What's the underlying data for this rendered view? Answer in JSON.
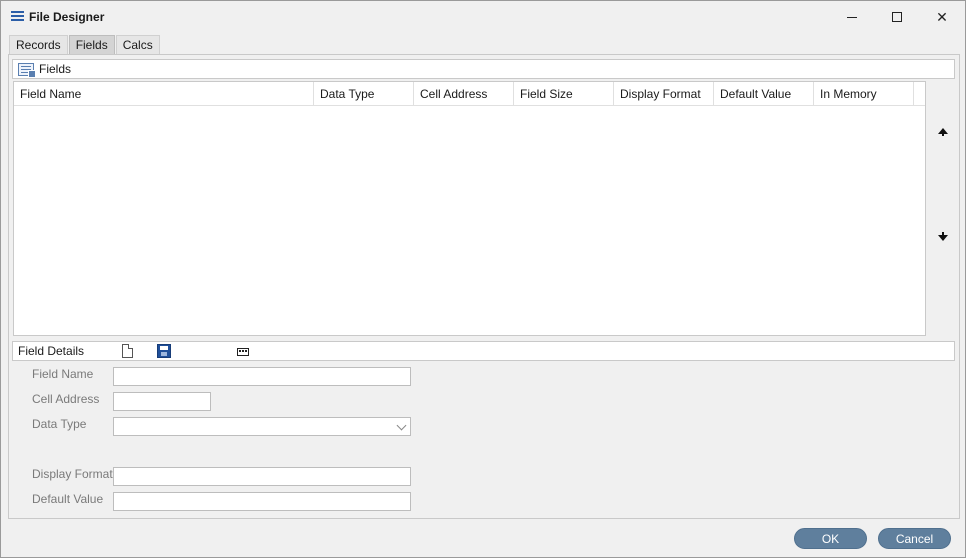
{
  "window": {
    "title": "File Designer",
    "icon": "menu-icon"
  },
  "tabs": [
    {
      "label": "Records",
      "active": false
    },
    {
      "label": "Fields",
      "active": true
    },
    {
      "label": "Calcs",
      "active": false
    }
  ],
  "fields_section": {
    "title": "Fields",
    "icon": "grid-icon",
    "columns": [
      "Field Name",
      "Data Type",
      "Cell Address",
      "Field Size",
      "Display Format",
      "Default Value",
      "In Memory"
    ],
    "rows": []
  },
  "field_details": {
    "title": "Field Details",
    "toolbar_icons": [
      "new-document-icon",
      "save-icon",
      "memory-icon"
    ],
    "form": {
      "field_name_label": "Field Name",
      "field_name_value": "",
      "cell_address_label": "Cell Address",
      "cell_address_value": "",
      "data_type_label": "Data Type",
      "data_type_value": "",
      "display_format_label": "Display Format",
      "display_format_value": "",
      "default_value_label": "Default Value",
      "default_value_value": ""
    }
  },
  "buttons": {
    "ok": "OK",
    "cancel": "Cancel"
  },
  "colors": {
    "button_bg": "#5f7f9d",
    "window_bg": "#f0f0f0",
    "icon_blue": "#2b5ea7"
  }
}
